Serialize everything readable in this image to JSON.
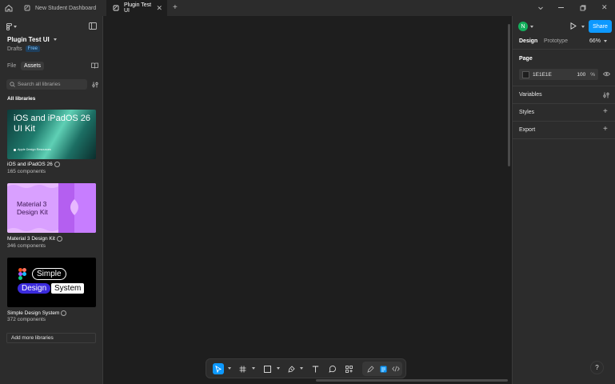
{
  "tabs": [
    {
      "label": "New Student Dashboard"
    },
    {
      "label": "Plugin Test UI"
    }
  ],
  "file": {
    "name": "Plugin Test UI",
    "location": "Drafts",
    "plan_badge": "Free"
  },
  "left_tabs": {
    "file": "File",
    "assets": "Assets"
  },
  "search": {
    "placeholder": "Search all libraries"
  },
  "libraries_heading": "All libraries",
  "libraries": [
    {
      "name": "iOS and iPadOS 26",
      "count": "165 components",
      "thumb_line1": "iOS and iPadOS 26",
      "thumb_line2": "UI Kit",
      "thumb_caption": "Apple Design Resources"
    },
    {
      "name": "Material 3 Design Kit",
      "count": "346 components",
      "thumb_line1": "Material 3",
      "thumb_line2": "Design Kit"
    },
    {
      "name": "Simple Design System",
      "count": "372 components",
      "thumb_words": [
        "Simple",
        "Design",
        "System"
      ]
    }
  ],
  "add_libraries": "Add more libraries",
  "right": {
    "avatar_initial": "N",
    "share_label": "Share",
    "tabs": {
      "design": "Design",
      "prototype": "Prototype"
    },
    "zoom": "66%",
    "page_heading": "Page",
    "page_color": "1E1E1E",
    "page_opacity": "100",
    "percent": "%",
    "sections": [
      "Variables",
      "Styles",
      "Export"
    ]
  },
  "help": "?",
  "colors": {
    "accent": "#0d99ff",
    "panel": "#2c2c2c",
    "canvas": "#1e1e1e",
    "avatar": "#14ae5c",
    "material": "#c77dff"
  }
}
